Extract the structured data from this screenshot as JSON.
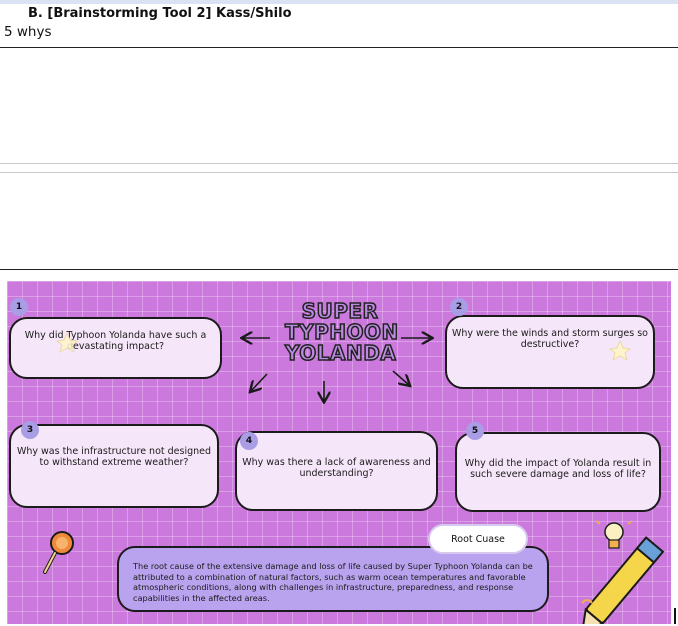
{
  "header": {
    "title": "B.  [Brainstorming Tool 2] Kass/Shilo",
    "subtitle": "5 whys"
  },
  "diagram": {
    "central_topic": [
      "SUPER",
      "TYPHOON",
      "YOLANDA"
    ],
    "whys": [
      {
        "number": "1",
        "question": "Why did Typhoon Yolanda have such a devastating impact?"
      },
      {
        "number": "2",
        "question": "Why were the winds and storm surges so destructive?"
      },
      {
        "number": "3",
        "question": "Why was the infrastructure not designed to withstand extreme weather?"
      },
      {
        "number": "4",
        "question": "Why was there a lack of awareness and understanding?"
      },
      {
        "number": "5",
        "question": "Why did the impact of Yolanda result in such severe damage and loss of life?"
      }
    ],
    "root_cause_label": "Root Cuase",
    "root_cause_text": "The root cause of the extensive damage and loss of life caused by Super Typhoon Yolanda can be attributed to a combination of natural factors, such as warm ocean temperatures and favorable atmospheric conditions, along with challenges in infrastructure, preparedness, and response capabilities in the affected areas.",
    "colors": {
      "canvas": "#cc79dd",
      "box_fill": "#f6e6f9",
      "badge": "#a99de6",
      "root_box": "#b9a3ee"
    },
    "icons": [
      "magnifier-icon",
      "lightbulb-icon",
      "pencil-icon",
      "star-icon",
      "arrow-icon"
    ]
  }
}
